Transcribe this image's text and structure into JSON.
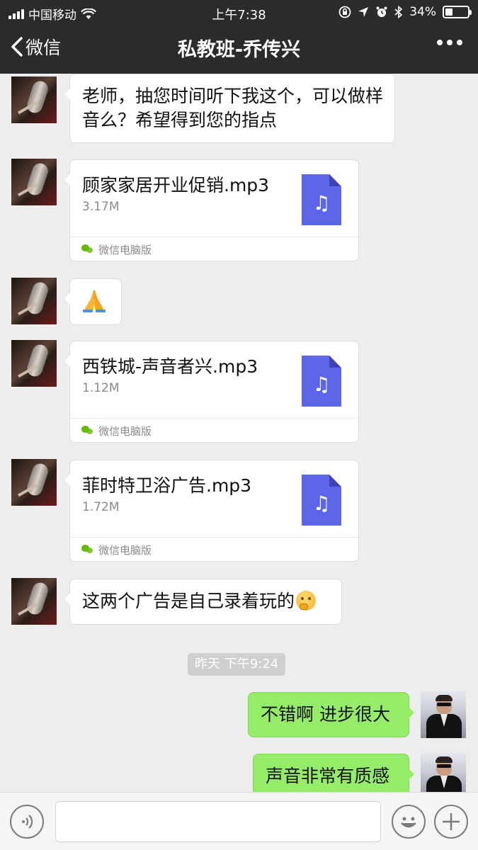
{
  "status": {
    "carrier": "中国移动",
    "time": "上午7:38",
    "battery": "34%",
    "battery_level": 0.34
  },
  "nav": {
    "back_label": "微信",
    "title": "私教班-乔传兴"
  },
  "messages": [
    {
      "type": "text",
      "side": "left",
      "text": "老师，抽您时间听下我这个，可以做样音么？希望得到您的指点"
    },
    {
      "type": "file",
      "side": "left",
      "name": "顾家家居开业促销.mp3",
      "size": "3.17M",
      "source": "微信电脑版"
    },
    {
      "type": "emoji",
      "side": "left",
      "emoji": "folded-hands"
    },
    {
      "type": "file",
      "side": "left",
      "name": "西铁城-声音者兴.mp3",
      "size": "1.12M",
      "source": "微信电脑版"
    },
    {
      "type": "file",
      "side": "left",
      "name": "菲时特卫浴广告.mp3",
      "size": "1.72M",
      "source": "微信电脑版"
    },
    {
      "type": "text",
      "side": "left",
      "text": "这两个广告是自己录着玩的",
      "emoji": "thinking-face"
    },
    {
      "type": "timestamp",
      "text": "昨天 下午9:24"
    },
    {
      "type": "text",
      "side": "right",
      "text": "不错啊 进步很大"
    },
    {
      "type": "text",
      "side": "right",
      "text": "声音非常有质感"
    }
  ],
  "colors": {
    "nav_bg": "#2b2b2d",
    "chat_bg": "#ededed",
    "self_bubble": "#95ec69",
    "file_icon": "#5c66e6",
    "source_icon": "#62b900"
  },
  "icons": {
    "voice": "voice-icon",
    "emoji": "emoji-icon",
    "add": "add-icon",
    "music": "music-note-icon"
  }
}
